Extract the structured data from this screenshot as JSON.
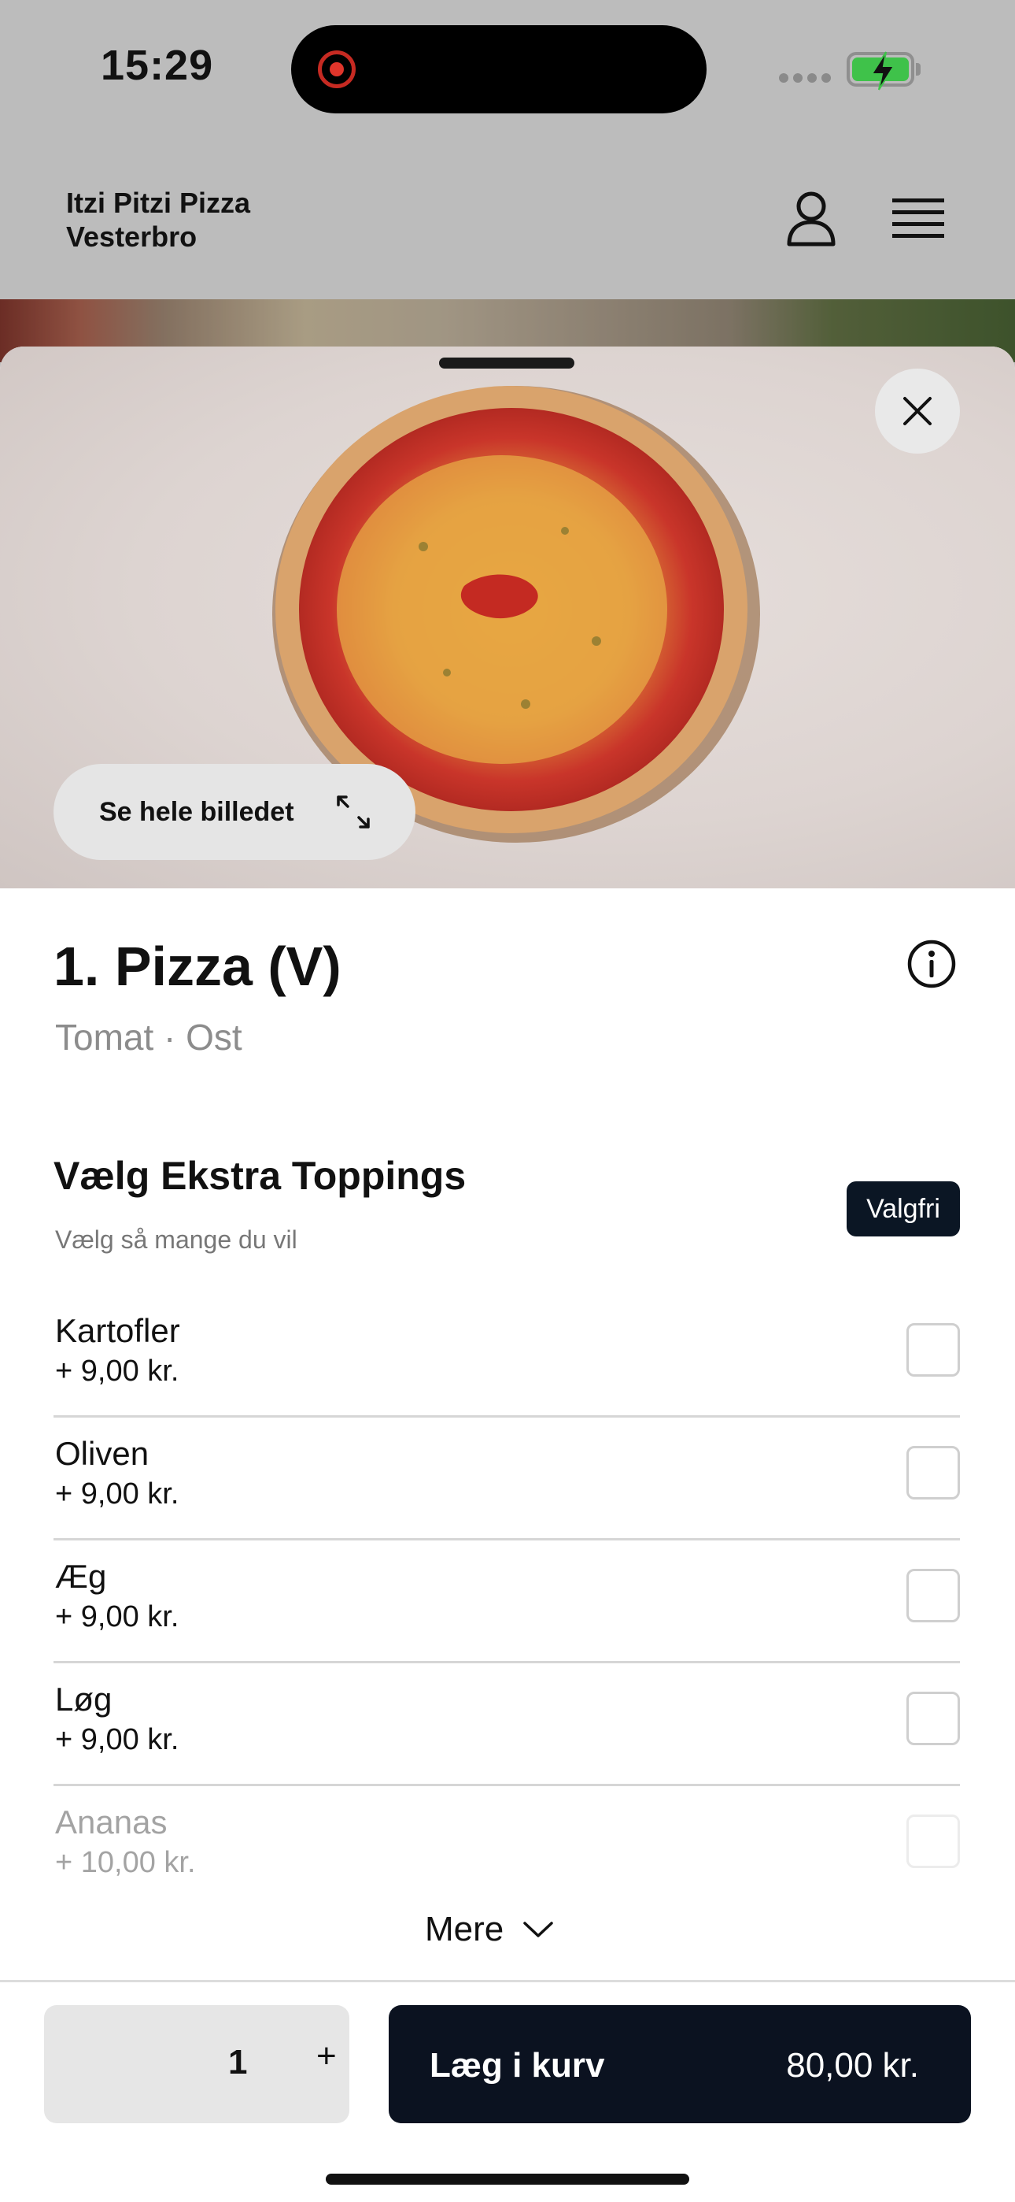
{
  "status_bar": {
    "time": "15:29",
    "record_indicator_color": "#e0352b",
    "battery_color": "#3fc24a",
    "battery_state": "charging"
  },
  "header": {
    "restaurant_line1": "Itzi Pitzi Pizza",
    "restaurant_line2": "Vesterbro",
    "icons": [
      "profile-icon",
      "menu-icon"
    ]
  },
  "hero": {
    "see_image_label": "Se hele billedet",
    "icons": [
      "close-icon",
      "expand-icon"
    ]
  },
  "product": {
    "title": "1. Pizza (V)",
    "description": "Tomat · Ost"
  },
  "toppings": {
    "title": "Vælg Ekstra Toppings",
    "subtitle": "Vælg så mange du vil",
    "badge": "Valgfri",
    "items": [
      {
        "name": "Kartofler",
        "price": "+ 9,00 kr.",
        "checked": false
      },
      {
        "name": "Oliven",
        "price": "+ 9,00 kr.",
        "checked": false
      },
      {
        "name": "Æg",
        "price": "+ 9,00 kr.",
        "checked": false
      },
      {
        "name": "Løg",
        "price": "+ 9,00 kr.",
        "checked": false
      },
      {
        "name": "Ananas",
        "price": "+ 10,00 kr.",
        "checked": false
      }
    ],
    "more_label": "Mere"
  },
  "cart": {
    "quantity": "1",
    "plus_label": "+",
    "add_label": "Læg i kurv",
    "price": "80,00 kr."
  },
  "colors": {
    "primary_dark": "#0b1220",
    "muted_text": "#8c8c8c"
  }
}
